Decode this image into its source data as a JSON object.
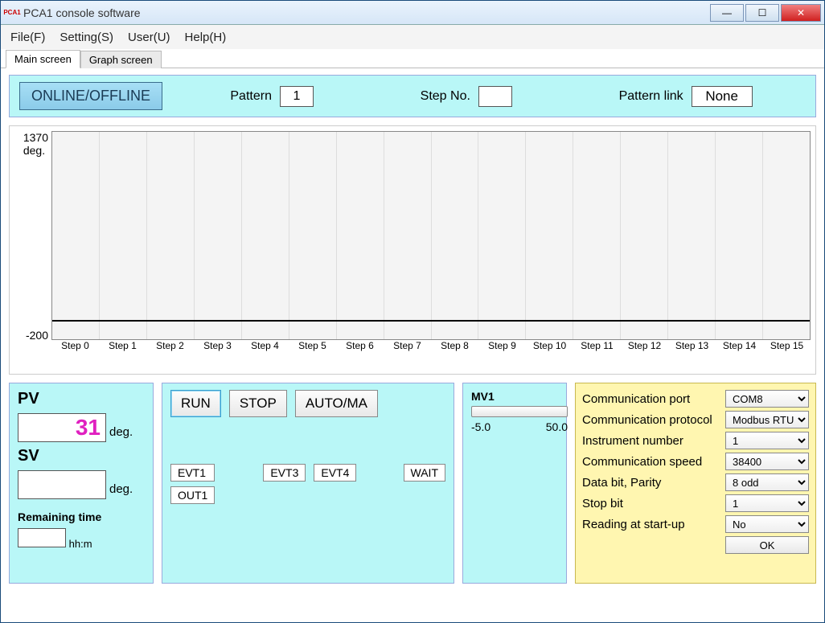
{
  "window": {
    "title": "PCA1 console software"
  },
  "menu": {
    "file": "File(F)",
    "setting": "Setting(S)",
    "user": "User(U)",
    "help": "Help(H)"
  },
  "tabs": {
    "main": "Main screen",
    "graph": "Graph screen"
  },
  "top": {
    "online": "ONLINE/OFFLINE",
    "pattern_lbl": "Pattern",
    "pattern_val": "1",
    "step_lbl": "Step No.",
    "step_val": "",
    "link_lbl": "Pattern link",
    "link_val": "None"
  },
  "chart_data": {
    "type": "line",
    "title": "",
    "xlabel": "",
    "ylabel": "deg.",
    "ylim": [
      -200,
      1370
    ],
    "categories": [
      "Step 0",
      "Step 1",
      "Step 2",
      "Step 3",
      "Step 4",
      "Step 5",
      "Step 6",
      "Step 7",
      "Step 8",
      "Step 9",
      "Step 10",
      "Step 11",
      "Step 12",
      "Step 13",
      "Step 14",
      "Step 15"
    ],
    "series": [
      {
        "name": "SV",
        "values": [
          0,
          0,
          0,
          0,
          0,
          0,
          0,
          0,
          0,
          0,
          0,
          0,
          0,
          0,
          0,
          0
        ]
      }
    ],
    "y_ticks": {
      "top": "1370",
      "unit": "deg.",
      "bottom": "-200"
    }
  },
  "pv": {
    "label": "PV",
    "value": "31",
    "unit": "deg."
  },
  "sv": {
    "label": "SV",
    "value": "",
    "unit": "deg."
  },
  "remaining": {
    "label": "Remaining time",
    "unit": "hh:m",
    "value": ""
  },
  "ctl": {
    "run": "RUN",
    "stop": "STOP",
    "automa": "AUTO/MA"
  },
  "events": {
    "evt1": "EVT1",
    "evt3": "EVT3",
    "evt4": "EVT4",
    "wait": "WAIT",
    "out1": "OUT1"
  },
  "mv": {
    "label": "MV1",
    "min": "-5.0",
    "max": "50.0"
  },
  "cfg": {
    "port_lbl": "Communication port",
    "port_val": "COM8",
    "proto_lbl": "Communication protocol",
    "proto_val": "Modbus RTU",
    "instr_lbl": "Instrument number",
    "instr_val": "1",
    "speed_lbl": "Communication speed",
    "speed_val": "38400",
    "parity_lbl": "Data bit, Parity",
    "parity_val": "8 odd",
    "stop_lbl": "Stop bit",
    "stop_val": "1",
    "startup_lbl": "Reading at start-up",
    "startup_val": "No",
    "ok": "OK"
  }
}
